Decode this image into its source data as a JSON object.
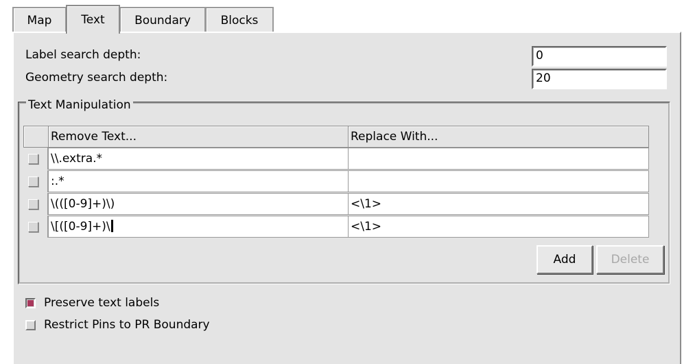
{
  "tabs": [
    {
      "label": "Map",
      "active": false
    },
    {
      "label": "Text",
      "active": true
    },
    {
      "label": "Boundary",
      "active": false
    },
    {
      "label": "Blocks",
      "active": false
    }
  ],
  "fields": {
    "label_search_depth": {
      "label": "Label search depth:",
      "value": "0"
    },
    "geometry_search_depth": {
      "label": "Geometry search depth:",
      "value": "20"
    }
  },
  "text_manipulation": {
    "title": "Text Manipulation",
    "columns": [
      "Remove Text...",
      "Replace With..."
    ],
    "rows": [
      {
        "remove": "\\\\.extra.*",
        "replace": ""
      },
      {
        "remove": ":.*",
        "replace": ""
      },
      {
        "remove": "\\(([0-9]+)\\)",
        "replace": "<\\1>"
      },
      {
        "remove": "\\[([0-9]+)\\",
        "replace": "<\\1>"
      }
    ],
    "add_label": "Add",
    "delete_label": "Delete"
  },
  "options": {
    "preserve_text_labels": {
      "label": "Preserve text labels",
      "checked": true
    },
    "restrict_pins": {
      "label": "Restrict Pins to PR Boundary",
      "checked": false
    }
  },
  "colors": {
    "check_on": "#a8385c",
    "panel_bg": "#e4e4e4"
  }
}
